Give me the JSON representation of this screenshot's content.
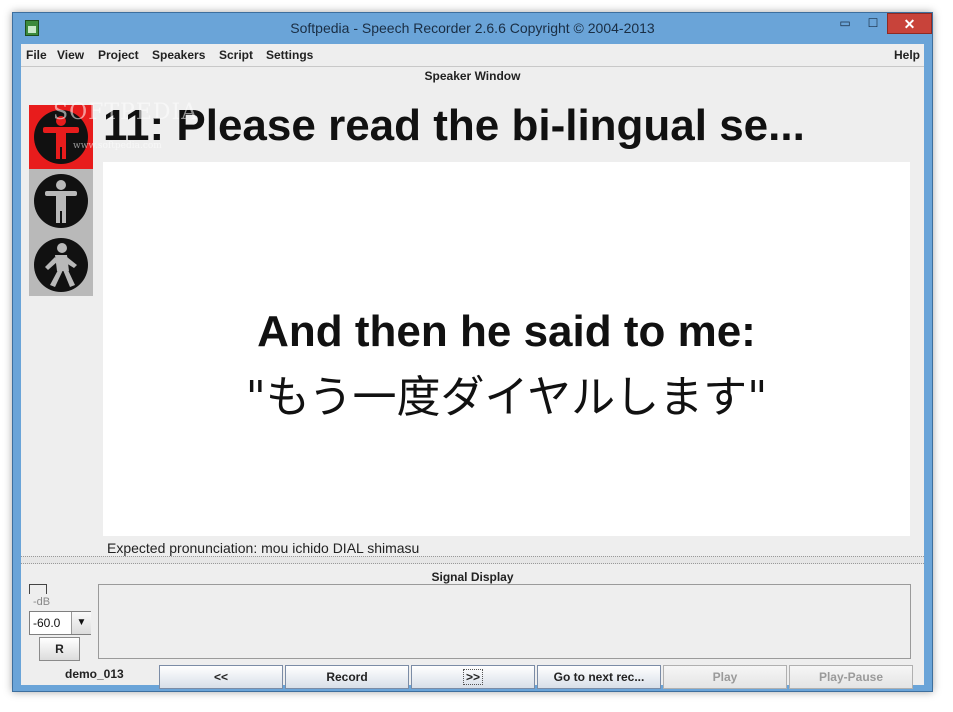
{
  "window": {
    "title": "Softpedia - Speech Recorder 2.6.6 Copyright © 2004-2013",
    "min_glyph": "▭",
    "max_glyph": "☐",
    "close_glyph": "✕"
  },
  "menu": {
    "file": "File",
    "view": "View",
    "project": "Project",
    "speakers": "Speakers",
    "script": "Script",
    "settings": "Settings",
    "help": "Help"
  },
  "speaker_window": {
    "title": "Speaker Window",
    "watermark": "SOFTPEDIA",
    "watermark_url": "www.softpedia.com",
    "prompt_title": "11:  Please read the bi-lingual se...",
    "prompt_line1": "And then he said to me:",
    "prompt_line2": "\"もう一度ダイヤルします\"",
    "expected": "Expected pronunciation: mou ichido DIAL shimasu",
    "lights": {
      "red_color": "#e81c1c",
      "panel_color": "#b9b9b9"
    }
  },
  "signal_display": {
    "title": "Signal Display",
    "db_label": "-dB",
    "db_value": "-60.0",
    "r_label": "R"
  },
  "bottom": {
    "session": "demo_013",
    "back_label": "<<",
    "record_label": "Record",
    "forward_label": ">>",
    "next_label": "Go to next rec...",
    "play_label": "Play",
    "play_pause_label": "Play-Pause"
  }
}
